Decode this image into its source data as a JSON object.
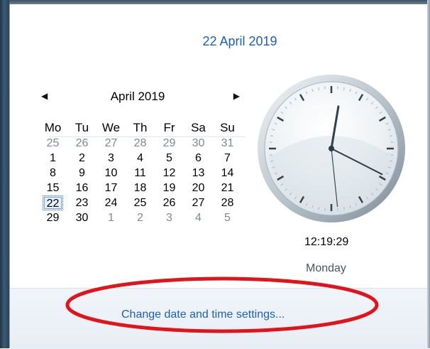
{
  "header": {
    "long_date": "22 April 2019"
  },
  "calendar": {
    "month_title": "April 2019",
    "prev_glyph": "◀",
    "next_glyph": "▶",
    "weekdays": [
      "Mo",
      "Tu",
      "We",
      "Th",
      "Fr",
      "Sa",
      "Su"
    ],
    "weeks": [
      [
        "25",
        "26",
        "27",
        "28",
        "29",
        "30",
        "31"
      ],
      [
        "1",
        "2",
        "3",
        "4",
        "5",
        "6",
        "7"
      ],
      [
        "8",
        "9",
        "10",
        "11",
        "12",
        "13",
        "14"
      ],
      [
        "15",
        "16",
        "17",
        "18",
        "19",
        "20",
        "21"
      ],
      [
        "22",
        "23",
        "24",
        "25",
        "26",
        "27",
        "28"
      ],
      [
        "29",
        "30",
        "1",
        "2",
        "3",
        "4",
        "5"
      ]
    ],
    "selected_day": "22"
  },
  "clock": {
    "time": "12:19:29",
    "weekday": "Monday"
  },
  "footer": {
    "settings_link": "Change date and time settings..."
  },
  "colors": {
    "link": "#1e5fb4",
    "annotation": "#e0141a"
  }
}
